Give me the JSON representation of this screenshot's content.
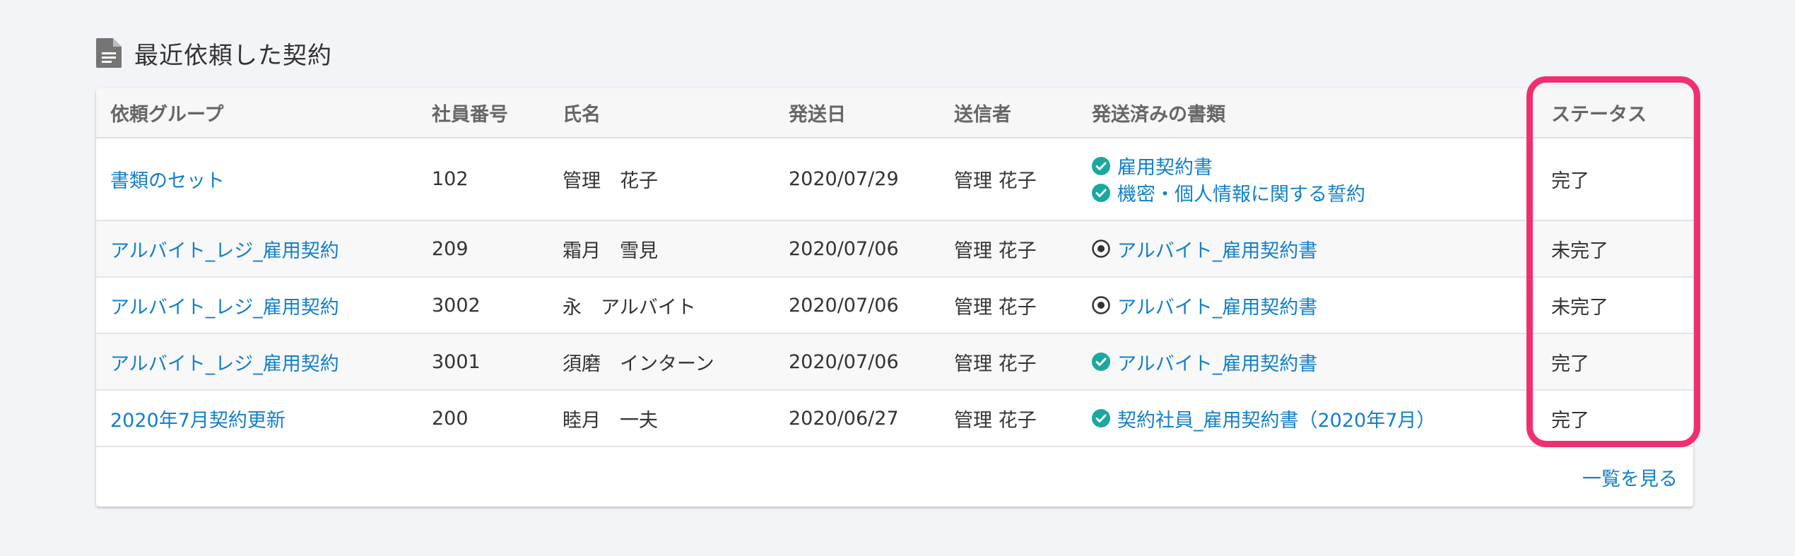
{
  "section": {
    "icon": "document-icon",
    "title": "最近依頼した契約"
  },
  "table": {
    "columns": [
      "依頼グループ",
      "社員番号",
      "氏名",
      "発送日",
      "送信者",
      "発送済みの書類",
      "ステータス"
    ],
    "rows": [
      {
        "group": "書類のセット",
        "employee_no": "102",
        "name": "管理　花子",
        "sent_date": "2020/07/29",
        "sender": "管理 花子",
        "documents": [
          {
            "icon": "check-circle-icon",
            "label": "雇用契約書"
          },
          {
            "icon": "check-circle-icon",
            "label": "機密・個人情報に関する誓約"
          }
        ],
        "status": "完了"
      },
      {
        "group": "アルバイト_レジ_雇用契約",
        "employee_no": "209",
        "name": "霜月　雪見",
        "sent_date": "2020/07/06",
        "sender": "管理 花子",
        "documents": [
          {
            "icon": "pending-circle-icon",
            "label": "アルバイト_雇用契約書"
          }
        ],
        "status": "未完了"
      },
      {
        "group": "アルバイト_レジ_雇用契約",
        "employee_no": "3002",
        "name": "永　アルバイト",
        "sent_date": "2020/07/06",
        "sender": "管理 花子",
        "documents": [
          {
            "icon": "pending-circle-icon",
            "label": "アルバイト_雇用契約書"
          }
        ],
        "status": "未完了"
      },
      {
        "group": "アルバイト_レジ_雇用契約",
        "employee_no": "3001",
        "name": "須磨　インターン",
        "sent_date": "2020/07/06",
        "sender": "管理 花子",
        "documents": [
          {
            "icon": "check-circle-icon",
            "label": "アルバイト_雇用契約書"
          }
        ],
        "status": "完了"
      },
      {
        "group": "2020年7月契約更新",
        "employee_no": "200",
        "name": "睦月　一夫",
        "sent_date": "2020/06/27",
        "sender": "管理 花子",
        "documents": [
          {
            "icon": "check-circle-icon",
            "label": "契約社員_雇用契約書（2020年7月）"
          }
        ],
        "status": "完了"
      }
    ]
  },
  "footer": {
    "view_all": "一覧を見る"
  },
  "colors": {
    "link": "#1380c9",
    "check": "#1aa8a0",
    "highlight": "#f0306e"
  }
}
